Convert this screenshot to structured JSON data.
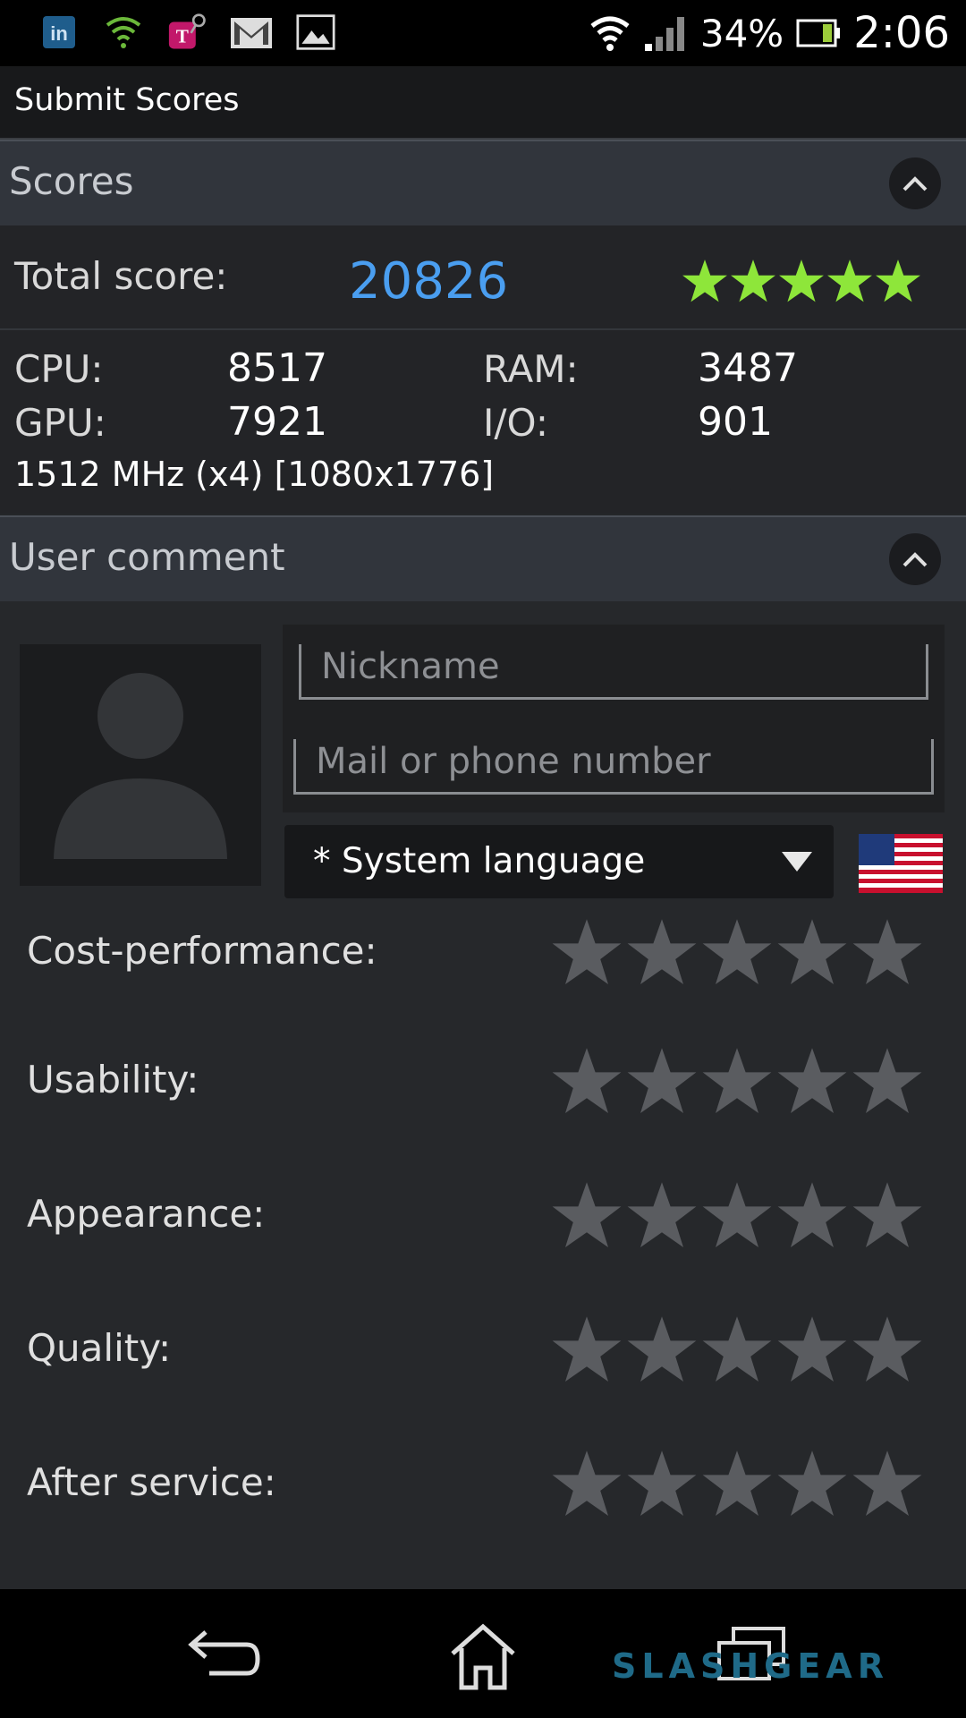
{
  "status_bar": {
    "icons_left": [
      "linkedin-icon",
      "wifi-shield-icon",
      "tmobile-icon",
      "gmail-icon",
      "gallery-icon"
    ],
    "battery_percent": "34%",
    "time": "2:06"
  },
  "action_bar": {
    "title": "Submit Scores"
  },
  "scores_section": {
    "header": "Scores",
    "total_label": "Total score:",
    "total_value": "20826",
    "total_stars": 5,
    "cpu_label": "CPU:",
    "cpu_value": "8517",
    "ram_label": "RAM:",
    "ram_value": "3487",
    "gpu_label": "GPU:",
    "gpu_value": "7921",
    "io_label": "I/O:",
    "io_value": "901",
    "device_info": "1512 MHz (x4) [1080x1776]"
  },
  "comment_section": {
    "header": "User comment",
    "nickname_placeholder": "Nickname",
    "contact_placeholder": "Mail or phone number",
    "language": "* System language",
    "ratings": [
      {
        "label": "Cost-performance:",
        "stars": 0
      },
      {
        "label": "Usability:",
        "stars": 0
      },
      {
        "label": "Appearance:",
        "stars": 0
      },
      {
        "label": "Quality:",
        "stars": 0
      },
      {
        "label": "After service:",
        "stars": 0
      }
    ]
  },
  "nav_bar": {
    "buttons": [
      "back-icon",
      "home-icon",
      "recents-icon"
    ]
  },
  "watermark": "SLASHGEAR",
  "colors": {
    "accent_blue": "#4a9ef0",
    "star_green": "#8ee63a",
    "star_empty": "#5a5c60"
  }
}
